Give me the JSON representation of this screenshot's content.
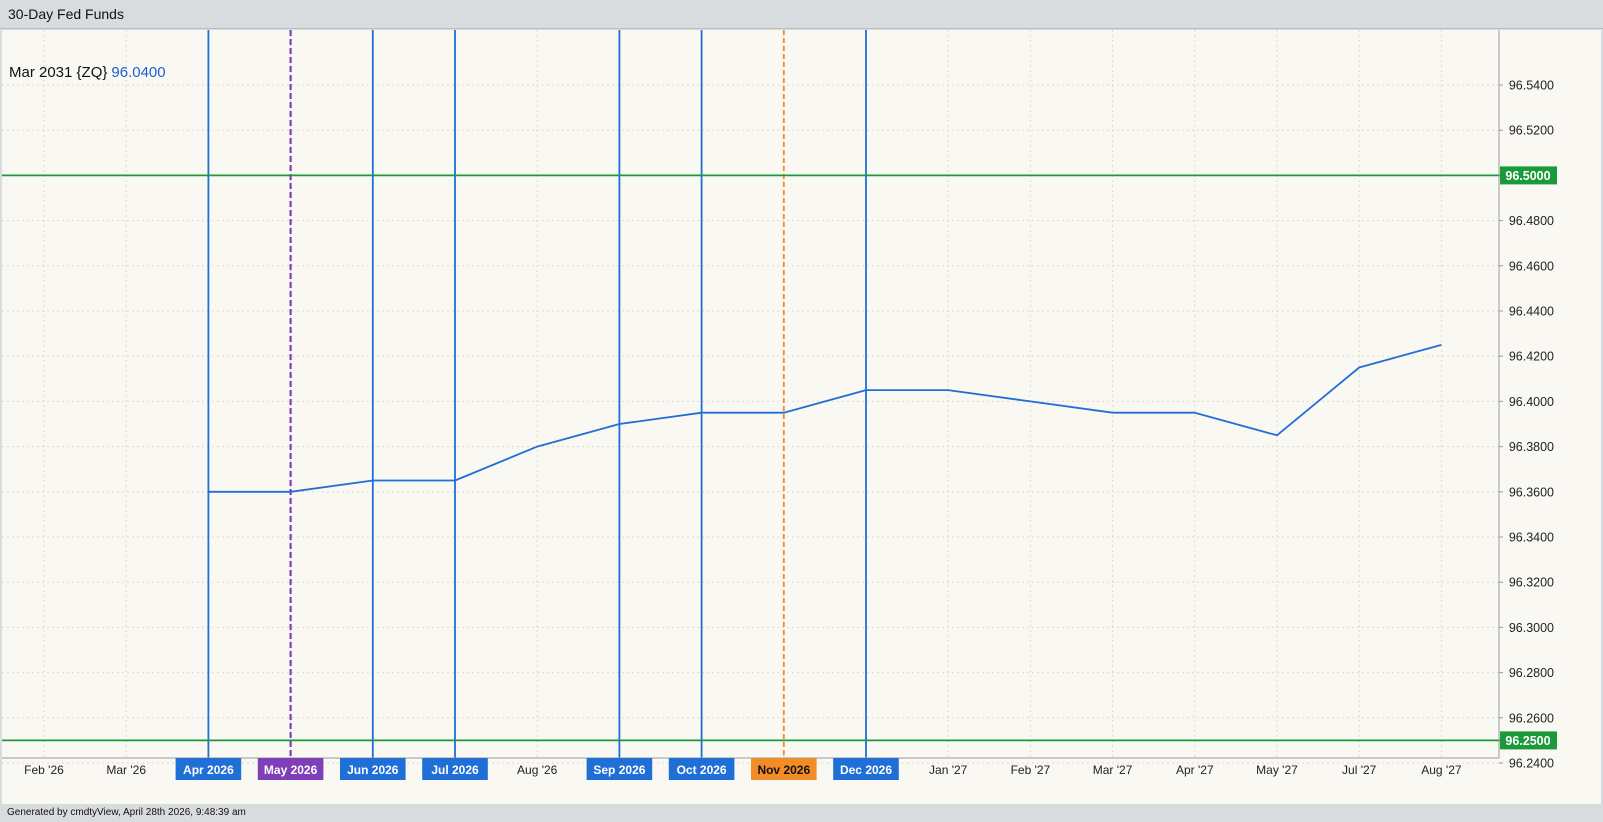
{
  "window": {
    "title": "30-Day Fed Funds"
  },
  "footer": {
    "text": "Generated by cmdtyView, April 28th 2026, 9:48:39 am"
  },
  "colors": {
    "background": "#faf8f2",
    "series": "#1f6fd6",
    "reference_line": "#1a9a3a",
    "fomc_line": "#1f6fd6",
    "current_month": "#7e3fb8",
    "highlight_month": "#f28c28"
  },
  "chart_data": {
    "type": "line",
    "title": "",
    "series_label": {
      "name": "Mar 2031 {ZQ}",
      "value": "96.0400"
    },
    "xlabel": "",
    "ylabel": "",
    "categories": [
      "Feb '26",
      "Mar '26",
      "Apr 2026",
      "May 2026",
      "Jun 2026",
      "Jul 2026",
      "Aug '26",
      "Sep 2026",
      "Oct 2026",
      "Nov 2026",
      "Dec 2026",
      "Jan '27",
      "Feb '27",
      "Mar '27",
      "Apr '27",
      "May '27",
      "Jul '27",
      "Aug '27"
    ],
    "series": [
      {
        "values": [
          null,
          null,
          96.36,
          96.36,
          96.365,
          96.365,
          96.38,
          96.39,
          96.395,
          96.395,
          96.405,
          96.405,
          96.4,
          96.395,
          96.395,
          96.385,
          96.415,
          96.425
        ]
      }
    ],
    "yticks": [
      "96.2400",
      "96.2600",
      "96.2800",
      "96.3000",
      "96.3200",
      "96.3400",
      "96.3600",
      "96.3800",
      "96.4000",
      "96.4200",
      "96.4400",
      "96.4600",
      "96.4800",
      "96.5200",
      "96.5400"
    ],
    "ylim": [
      96.235,
      96.555
    ],
    "reference_lines": [
      {
        "label": "96.5000",
        "value": 96.5
      },
      {
        "label": "96.2500",
        "value": 96.25
      }
    ],
    "marked_months": [
      {
        "category": "Apr 2026",
        "style": "solid",
        "kind": "fomc"
      },
      {
        "category": "May 2026",
        "style": "dashed",
        "kind": "current"
      },
      {
        "category": "Jun 2026",
        "style": "solid",
        "kind": "fomc"
      },
      {
        "category": "Jul 2026",
        "style": "solid",
        "kind": "fomc"
      },
      {
        "category": "Sep 2026",
        "style": "solid",
        "kind": "fomc"
      },
      {
        "category": "Oct 2026",
        "style": "solid",
        "kind": "fomc"
      },
      {
        "category": "Nov 2026",
        "style": "dashed",
        "kind": "highlight"
      },
      {
        "category": "Dec 2026",
        "style": "solid",
        "kind": "fomc"
      }
    ],
    "grid": true
  }
}
